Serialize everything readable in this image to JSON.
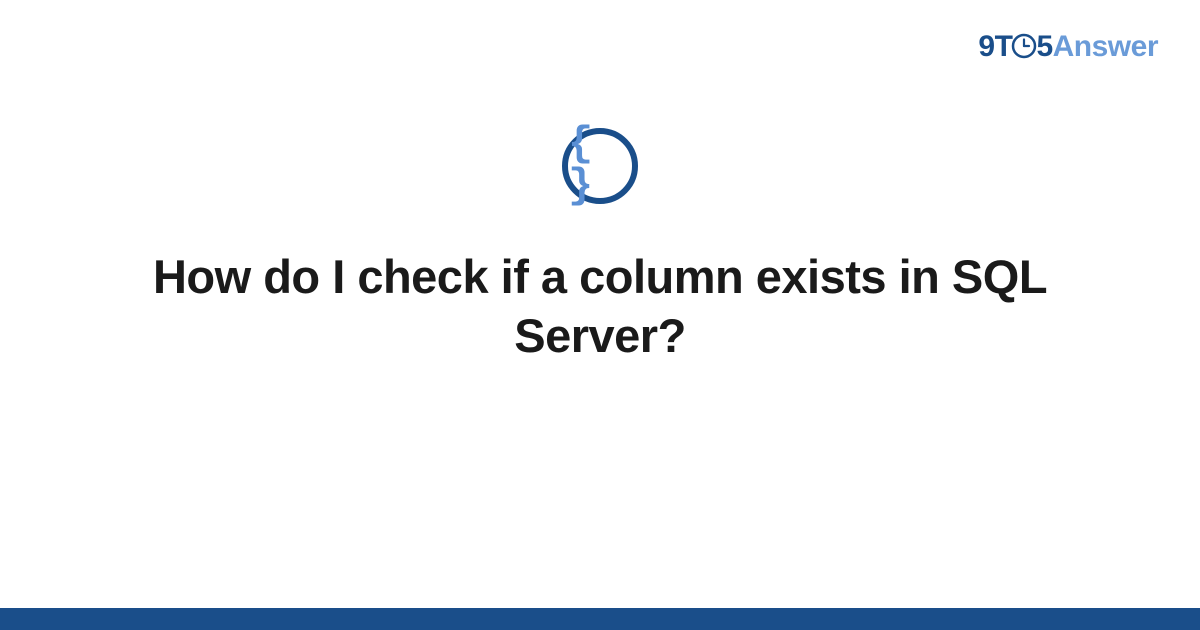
{
  "logo": {
    "nine": "9",
    "t": "T",
    "five": "5",
    "answer": "Answer"
  },
  "icon": {
    "braces": "{ }"
  },
  "title": "How do I check if a column exists in SQL Server?"
}
